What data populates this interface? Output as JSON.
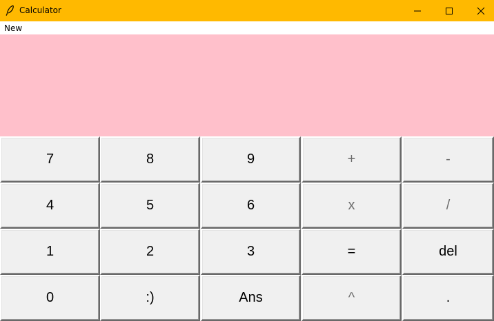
{
  "window": {
    "title": "Calculator",
    "app_icon": "feather-icon",
    "titlebar_color": "#ffb900",
    "controls": [
      "minimize-icon",
      "maximize-icon",
      "close-icon"
    ]
  },
  "menu": {
    "items": [
      "New"
    ]
  },
  "display": {
    "value": "",
    "background": "#ffc0cb"
  },
  "keypad": {
    "rows": [
      [
        "7",
        "8",
        "9",
        "+",
        "-"
      ],
      [
        "4",
        "5",
        "6",
        "x",
        "/"
      ],
      [
        "1",
        "2",
        "3",
        "=",
        "del"
      ],
      [
        "0",
        ":)",
        "Ans",
        "^",
        "."
      ]
    ]
  }
}
